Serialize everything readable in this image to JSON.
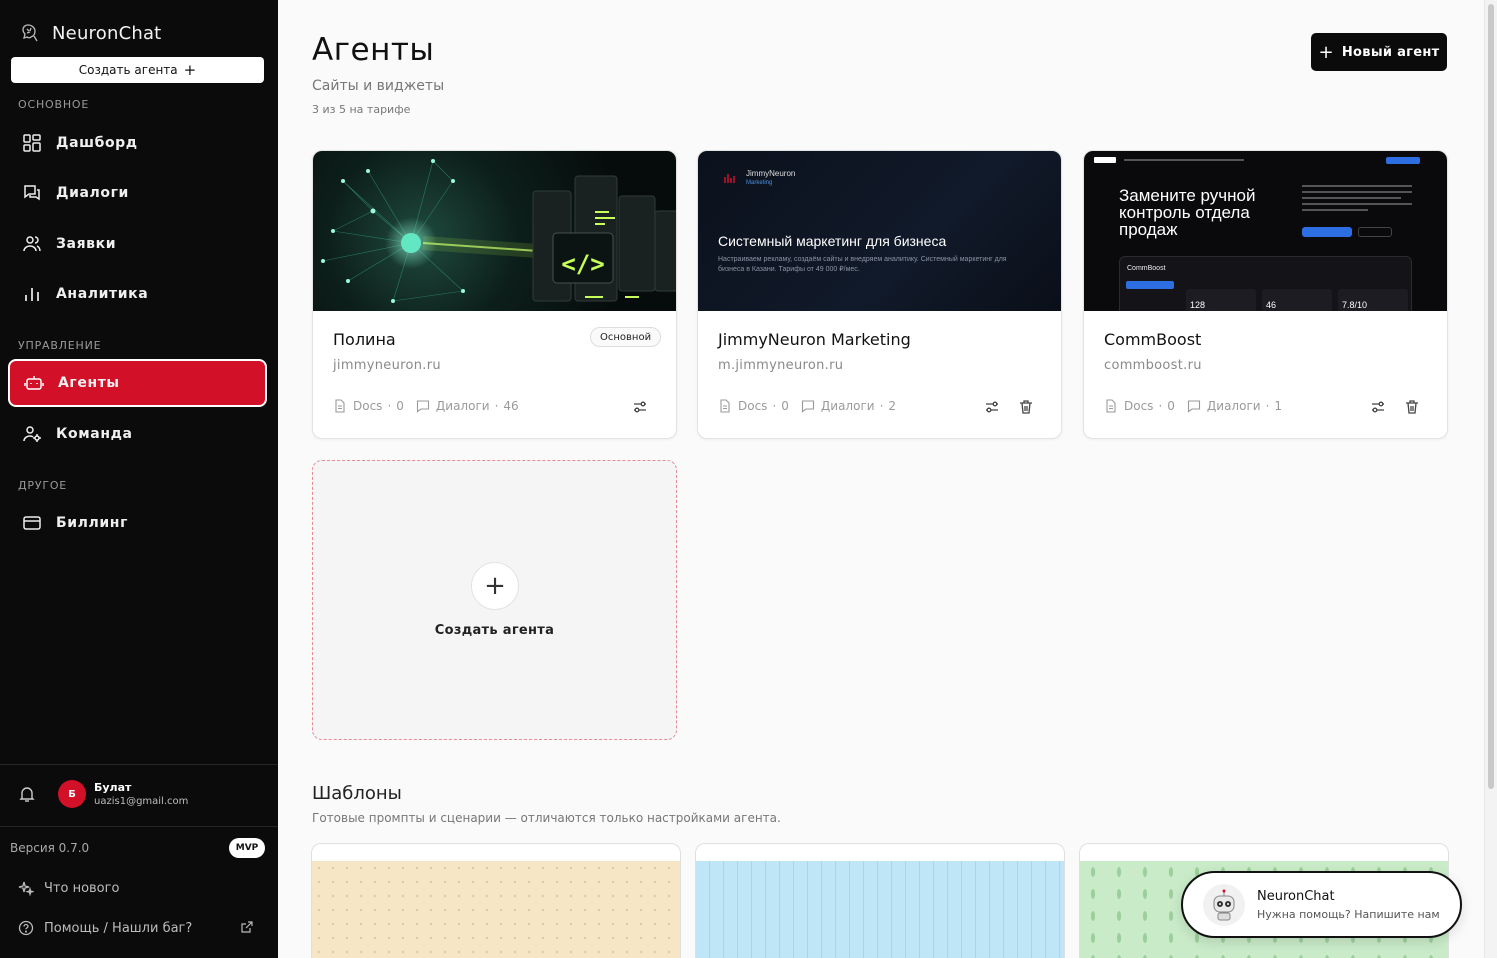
{
  "app": {
    "name": "NeuronChat",
    "create_agent_label": "Создать агента"
  },
  "sidebar": {
    "sections": {
      "main": "ОСНОВНОЕ",
      "manage": "УПРАВЛЕНИЕ",
      "other": "ДРУГОЕ"
    },
    "items": [
      {
        "label": "Дашборд",
        "icon": "dashboard-icon"
      },
      {
        "label": "Диалоги",
        "icon": "chat-icon"
      },
      {
        "label": "Заявки",
        "icon": "users-icon"
      },
      {
        "label": "Аналитика",
        "icon": "analytics-icon"
      },
      {
        "label": "Агенты",
        "icon": "bot-icon",
        "active": true
      },
      {
        "label": "Команда",
        "icon": "team-icon"
      },
      {
        "label": "Биллинг",
        "icon": "card-icon"
      }
    ],
    "user": {
      "initial": "Б",
      "name": "Булат",
      "email": "uazis1@gmail.com"
    },
    "version": "Версия 0.7.0",
    "badge": "MVP",
    "whats_new": "Что нового",
    "help": "Помощь / Нашли баг?"
  },
  "header": {
    "title": "Агенты",
    "subtitle": "Сайты и виджеты",
    "quota": "3 из 5 на тарифе",
    "new_agent_label": "Новый агент"
  },
  "agents": [
    {
      "name": "Полина",
      "domain": "jimmyneuron.ru",
      "badge": "Основной",
      "docs_label": "Docs",
      "docs": "0",
      "dialogs_label": "Диалоги",
      "dialogs": "46"
    },
    {
      "name": "JimmyNeuron Marketing",
      "domain": "m.jimmyneuron.ru",
      "docs_label": "Docs",
      "docs": "0",
      "dialogs_label": "Диалоги",
      "dialogs": "2",
      "thumb": {
        "brand": "JimmyNeuron",
        "brand_sub": "Marketing",
        "headline": "Системный маркетинг для бизнеса",
        "text": "Настраиваем рекламу, создаём сайты и внедряем аналитику. Системный маркетинг для бизнеса в Казани. Тарифы от 49 000 ₽/мес."
      }
    },
    {
      "name": "CommBoost",
      "domain": "commboost.ru",
      "docs_label": "Docs",
      "docs": "0",
      "dialogs_label": "Диалоги",
      "dialogs": "1",
      "thumb": {
        "headline": "Замените ручной контроль отдела продаж",
        "panel_brand": "CommBoost",
        "metrics": [
          "128",
          "46",
          "7.8/10"
        ]
      }
    }
  ],
  "create_card": {
    "label": "Создать агента"
  },
  "templates": {
    "title": "Шаблоны",
    "subtitle": "Готовые промпты и сценарии — отличаются только настройками агента."
  },
  "chat_widget": {
    "title": "NeuronChat",
    "subtitle": "Нужна помощь? Напишите нам"
  },
  "colors": {
    "accent": "#d21028",
    "sidebar_bg": "#0b0b0b",
    "dashed_border": "#e58b99"
  }
}
